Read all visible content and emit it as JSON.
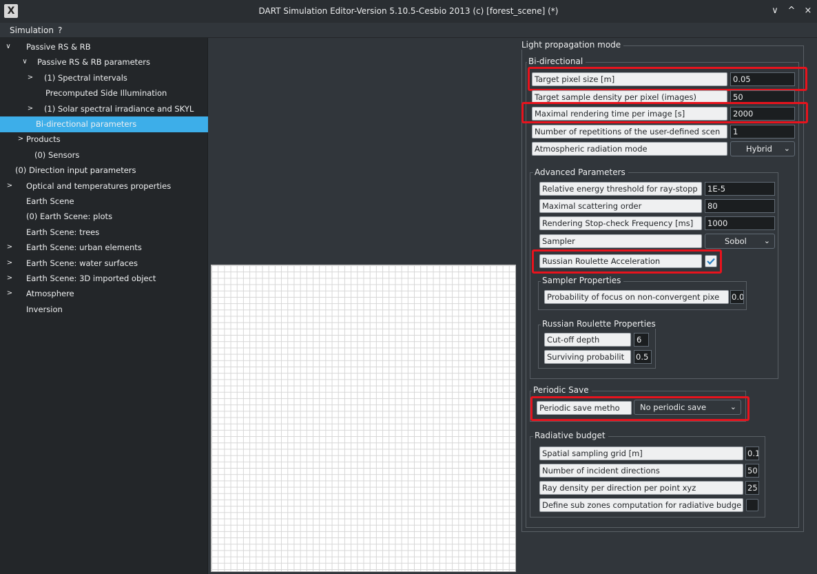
{
  "window": {
    "title": "DART Simulation Editor-Version 5.10.5-Cesbio 2013 (c) [forest_scene] (*)",
    "logo": "X",
    "controls": [
      "∨",
      "^",
      "×"
    ]
  },
  "menu": [
    "Simulation",
    "?"
  ],
  "tree": [
    {
      "label": "Passive RS & RB",
      "arrow": "∨"
    },
    {
      "label": "Passive RS & RB parameters",
      "arrow": "∨"
    },
    {
      "label": "(1) Spectral intervals",
      "arrow": ">"
    },
    {
      "label": "Precomputed Side Illumination",
      "arrow": ""
    },
    {
      "label": "(1) Solar spectral irradiance and SKYL",
      "arrow": ">"
    },
    {
      "label": "Bi-directional parameters",
      "arrow": "",
      "selected": true
    },
    {
      "label": "Products",
      "arrow": ">"
    },
    {
      "label": "(0) Sensors",
      "arrow": ""
    },
    {
      "label": "(0) Direction input parameters",
      "arrow": ""
    },
    {
      "label": "Optical and temperatures properties",
      "arrow": ">"
    },
    {
      "label": "Earth Scene",
      "arrow": ""
    },
    {
      "label": "(0) Earth Scene: plots",
      "arrow": ""
    },
    {
      "label": "Earth Scene: trees",
      "arrow": ""
    },
    {
      "label": "Earth Scene: urban elements",
      "arrow": ">"
    },
    {
      "label": "Earth Scene: water surfaces",
      "arrow": ">"
    },
    {
      "label": "Earth Scene: 3D imported object",
      "arrow": ">"
    },
    {
      "label": "Atmosphere",
      "arrow": ">"
    },
    {
      "label": "Inversion",
      "arrow": ""
    }
  ],
  "panel": {
    "light_title": "Light propagation mode",
    "bidir_title": "Bi-directional",
    "target_pixel_label": "Target pixel size    [m]",
    "target_pixel_value": "0.05",
    "sample_density_label": "Target sample density per pixel (images)",
    "sample_density_value": "50",
    "max_time_label": "Maximal rendering time per image    [s]",
    "max_time_value": "2000",
    "repetitions_label": "Number of repetitions of the user-defined scen",
    "repetitions_value": "1",
    "atmo_mode_label": "Atmospheric radiation mode",
    "atmo_mode_value": "Hybrid",
    "advanced_title": "Advanced Parameters",
    "energy_label": "Relative energy threshold for ray-stopp",
    "energy_value": "1E-5",
    "scatter_label": "Maximal scattering order",
    "scatter_value": "80",
    "stopcheck_label": "Rendering Stop-check Frequency    [ms]",
    "stopcheck_value": "1000",
    "sampler_label": "Sampler",
    "sampler_value": "Sobol",
    "rr_label": "Russian Roulette Acceleration",
    "sampler_props_title": "Sampler Properties",
    "focus_label": "Probability of focus on non-convergent pixe",
    "focus_value": "0.0",
    "rr_props_title": "Russian Roulette Properties",
    "cutoff_label": "Cut-off depth",
    "cutoff_value": "6",
    "surviving_label": "Surviving probabilit",
    "surviving_value": "0.5",
    "periodic_title": "Periodic Save",
    "periodic_label": "Periodic save metho",
    "periodic_value": "No periodic save",
    "radiative_title": "Radiative budget",
    "spatial_label": "Spatial sampling grid [m]",
    "spatial_value": "0.1",
    "incident_label": "Number of incident directions",
    "incident_value": "50",
    "ray_density_label": "Ray density per direction per point xyz",
    "ray_density_value": "25",
    "subzones_label": "Define sub zones computation for radiative budge"
  },
  "colors": {
    "highlight": "#e8131d",
    "selected": "#3daee9",
    "background": "#31363b"
  }
}
